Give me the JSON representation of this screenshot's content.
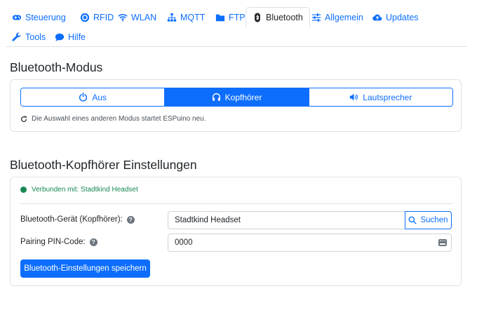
{
  "nav": {
    "tabs": [
      {
        "label": "Steuerung",
        "icon": "gamepad-icon"
      },
      {
        "label": "RFID",
        "icon": "dot-circle-icon"
      },
      {
        "label": "WLAN",
        "icon": "wifi-icon"
      },
      {
        "label": "MQTT",
        "icon": "sitemap-icon"
      },
      {
        "label": "FTP",
        "icon": "folder-icon"
      },
      {
        "label": "Bluetooth",
        "icon": "bluetooth-icon",
        "active": true
      },
      {
        "label": "Allgemein",
        "icon": "sliders-icon"
      },
      {
        "label": "Updates",
        "icon": "cloud-upload-icon"
      },
      {
        "label": "Tools",
        "icon": "wrench-icon"
      },
      {
        "label": "Hilfe",
        "icon": "comment-icon"
      }
    ]
  },
  "mode_section": {
    "title": "Bluetooth-Modus",
    "buttons": [
      {
        "label": "Aus",
        "icon": "power-icon",
        "active": false
      },
      {
        "label": "Kopfhörer",
        "icon": "headphones-icon",
        "active": true
      },
      {
        "label": "Lautsprecher",
        "icon": "speaker-icon",
        "active": false
      }
    ],
    "hint": "Die Auswahl eines anderen Modus startet ESPuino neu."
  },
  "headphone_section": {
    "title": "Bluetooth-Kopfhörer Einstellungen",
    "status": "Verbunden mit: Stadtkind Headset",
    "device_label": "Bluetooth-Gerät (Kopfhörer):",
    "device_value": "Stadtkind Headset",
    "search_label": "Suchen",
    "pin_label": "Pairing PIN-Code:",
    "pin_value": "0000",
    "save_label": "Bluetooth-Einstellungen speichern"
  },
  "colors": {
    "accent": "#0d6efd",
    "success": "#198754",
    "border": "#dee2e6"
  }
}
